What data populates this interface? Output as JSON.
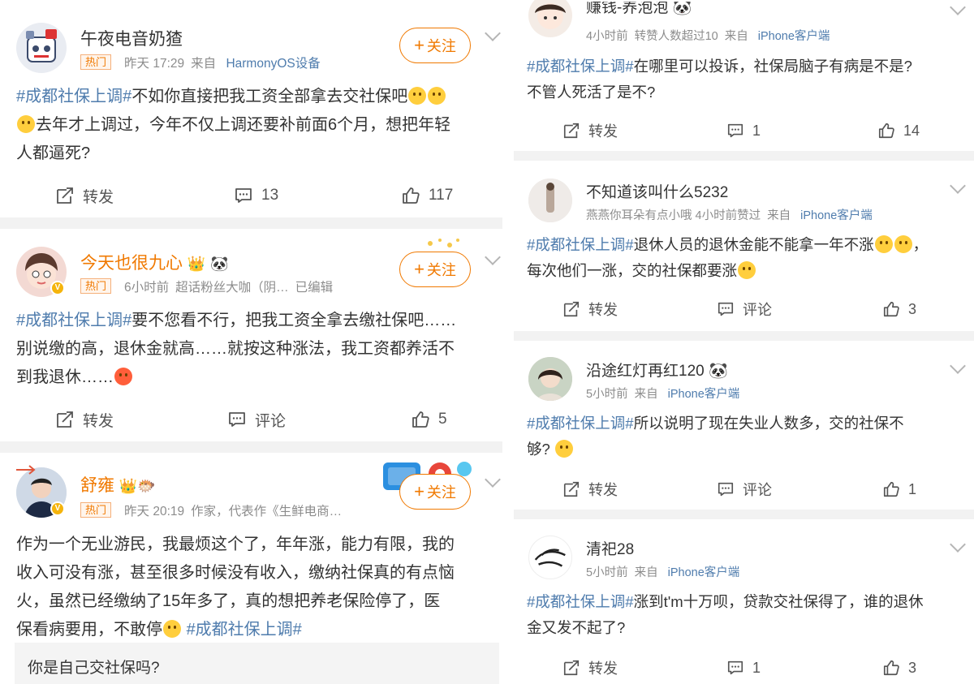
{
  "left": {
    "posts": [
      {
        "username": "午夜电音奶猹",
        "hot": "热门",
        "time": "昨天 17:29",
        "source_prefix": "来自",
        "source": "HarmonyOS设备",
        "follow": "关注",
        "tag": "#成都社保上调#",
        "text_after_tag": "不如你直接把我工资全部拿去交社保吧",
        "text_line2": "去年才上调过，今年不仅上调还要补前面6个月，想把年轻",
        "text_line3": "人都逼死?",
        "repost": "转发",
        "comments": "13",
        "likes": "117"
      },
      {
        "username": "今天也很九心",
        "hot": "热门",
        "time": "6小时前",
        "extra": "超话粉丝大咖（阴…",
        "edited": "已编辑",
        "follow": "关注",
        "tag": "#成都社保上调#",
        "text_after_tag": "要不您看不行，把我工资全拿去缴社保吧……",
        "text_line2": "别说缴的高，退休金就高……就按这种涨法，我工资都养活不",
        "text_line3": "到我退休……",
        "repost": "转发",
        "comments": "评论",
        "likes": "5"
      },
      {
        "username": "舒雍",
        "hot": "热门",
        "time": "昨天 20:19",
        "extra": "作家，代表作《生鲜电商…",
        "follow": "关注",
        "text_line1": "作为一个无业游民，我最烦这个了，年年涨，能力有限，我的",
        "text_line2": "收入可没有涨，甚至很多时候没有收入，缴纳社保真的有点恼",
        "text_line3": "火，虽然已经缴纳了15年多了，真的想把养老保险停了，医",
        "text_line4": "保看病要用，不敢停",
        "tag": "#成都社保上调#",
        "reply": "你是自己交社保吗?"
      }
    ]
  },
  "right": {
    "posts": [
      {
        "username": "赚钱-养泡泡",
        "time": "4小时前",
        "extra": "转赞人数超过10",
        "source_prefix": "来自",
        "source": "iPhone客户端",
        "tag": "#成都社保上调#",
        "text_after_tag": "在哪里可以投诉，社保局脑子有病是不是?",
        "text_line2": "不管人死活了是不?",
        "repost": "转发",
        "comments": "1",
        "likes": "14"
      },
      {
        "username": "不知道该叫什么5232",
        "time": "燕燕你耳朵有点小哦 4小时前赞过",
        "source_prefix": "来自",
        "source": "iPhone客户端",
        "tag": "#成都社保上调#",
        "text_after_tag": "退休人员的退休金能不能拿一年不涨",
        "text_line2": "每次他们一涨，交的社保都要涨",
        "repost": "转发",
        "comments": "评论",
        "likes": "3"
      },
      {
        "username": "沿途红灯再红120",
        "time": "5小时前",
        "source_prefix": "来自",
        "source": "iPhone客户端",
        "tag": "#成都社保上调#",
        "text_after_tag": "所以说明了现在失业人数多，交的社保不",
        "text_line2": "够?",
        "repost": "转发",
        "comments": "评论",
        "likes": "1"
      },
      {
        "username": "清祀28",
        "time": "5小时前",
        "source_prefix": "来自",
        "source": "iPhone客户端",
        "tag": "#成都社保上调#",
        "text_after_tag": "涨到t'm十万呗，贷款交社保得了，谁的退休",
        "text_line2": "金又发不起了?",
        "repost": "转发",
        "comments": "1",
        "likes": "3"
      }
    ]
  },
  "colors": {
    "accent": "#f07900",
    "link": "#4f7cad",
    "separator": "#f2f2f2"
  },
  "icons": [
    "repost-icon",
    "comment-icon",
    "like-icon",
    "chevron-down-icon",
    "plus-icon",
    "verified-icon"
  ]
}
